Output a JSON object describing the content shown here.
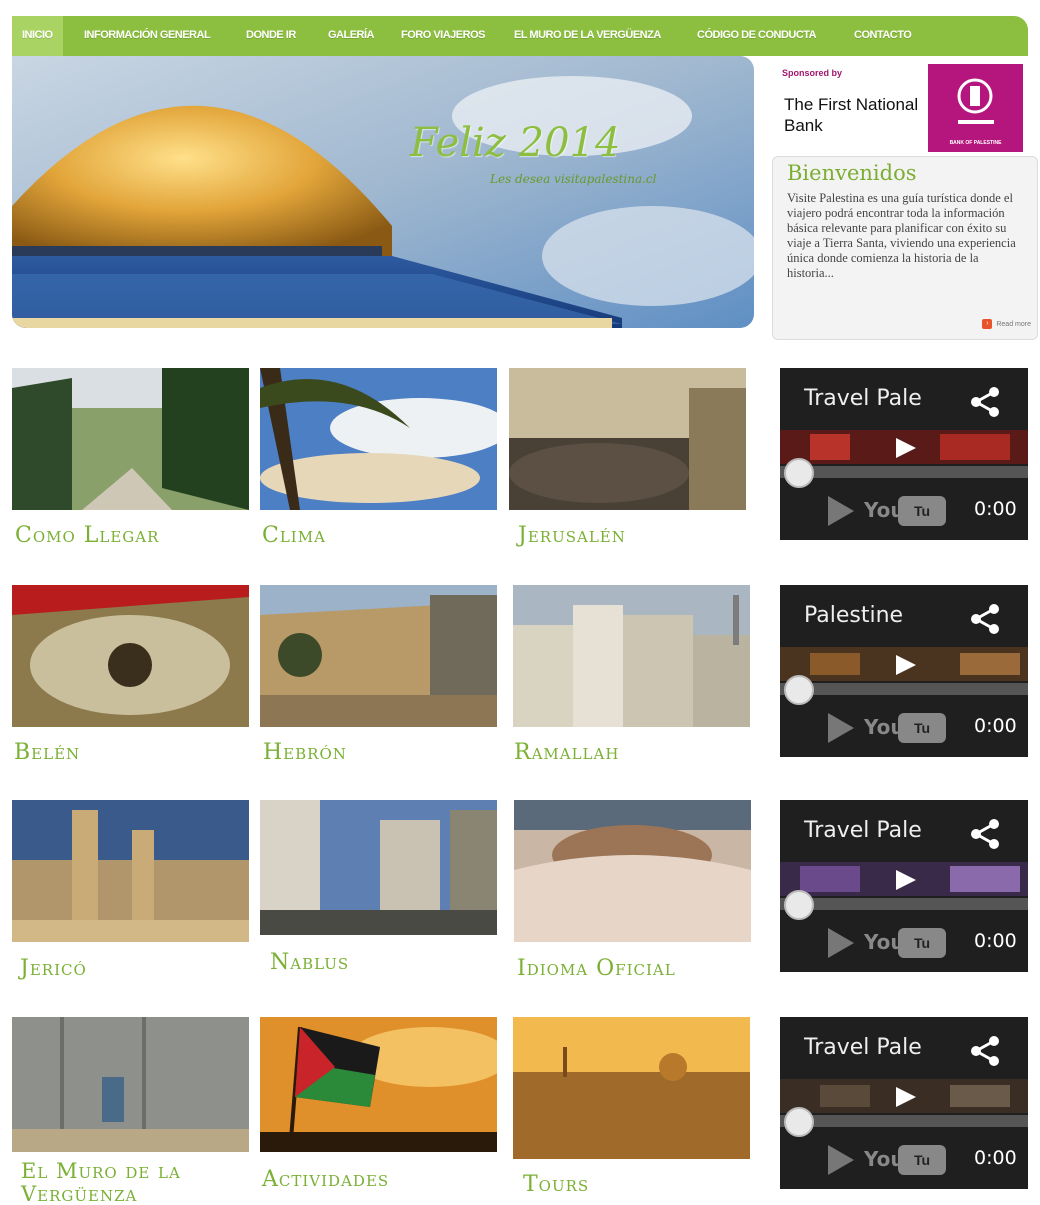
{
  "nav": {
    "items": [
      {
        "label": "Inicio"
      },
      {
        "label": "Información General"
      },
      {
        "label": "Donde Ir"
      },
      {
        "label": "Galería"
      },
      {
        "label": "Foro Viajeros"
      },
      {
        "label": "El Muro de la Vergüenza"
      },
      {
        "label": "Código de Conducta"
      },
      {
        "label": "Contacto"
      }
    ],
    "accent": "#8cbf3f"
  },
  "hero": {
    "title": "Feliz 2014",
    "subtitle": "Les desea visitapalestina.cl"
  },
  "sponsor": {
    "label": "Sponsored by",
    "name": "The First National Bank",
    "logo_text": "BANK OF PALESTINE"
  },
  "welcome": {
    "title": "Bienvenidos",
    "text": "Visite Palestina es una guía turística donde el viajero podrá encontrar toda la información básica relevante para planificar con éxito su viaje a Tierra Santa, viviendo una experiencia única donde comienza la historia de la historia...",
    "read_more": "Read more"
  },
  "tiles": [
    {
      "label": "Como Llegar"
    },
    {
      "label": "Clima"
    },
    {
      "label": "Jerusalén"
    },
    {
      "label": "Belén"
    },
    {
      "label": "Hebrón"
    },
    {
      "label": "Ramallah"
    },
    {
      "label": "Jericó"
    },
    {
      "label": "Nablus"
    },
    {
      "label": "Idioma Oficial"
    },
    {
      "label": "El Muro de la Vergüenza"
    },
    {
      "label": "Actividades"
    },
    {
      "label": "Tours"
    }
  ],
  "videos": [
    {
      "title": "Travel Pale",
      "time": "0:00",
      "yt": "You",
      "yt_box": "Tu"
    },
    {
      "title": "Palestine",
      "time": "0:00",
      "yt": "You",
      "yt_box": "Tu"
    },
    {
      "title": "Travel Pale",
      "time": "0:00",
      "yt": "You",
      "yt_box": "Tu"
    },
    {
      "title": "Travel Pale",
      "time": "0:00",
      "yt": "You",
      "yt_box": "Tu"
    }
  ]
}
